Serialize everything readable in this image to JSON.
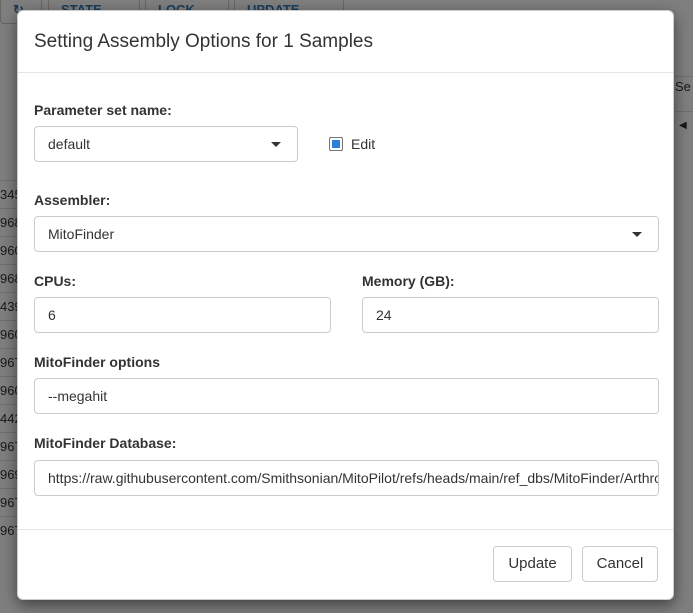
{
  "background": {
    "toolbar_buttons": [
      "STATE",
      "LOCK",
      "UPDATE"
    ],
    "row_fragments": [
      "345",
      "968",
      "960",
      "968",
      "439",
      "960",
      "967",
      "960",
      "442",
      "967",
      "969",
      "967",
      "967"
    ],
    "right_header": "Se"
  },
  "modal": {
    "title": "Setting Assembly Options for 1 Samples",
    "parameter_set": {
      "label": "Parameter set name:",
      "value": "default",
      "edit_label": "Edit",
      "edit_checked": true
    },
    "assembler": {
      "label": "Assembler:",
      "value": "MitoFinder"
    },
    "cpus": {
      "label": "CPUs:",
      "value": "6"
    },
    "memory": {
      "label": "Memory (GB):",
      "value": "24"
    },
    "options": {
      "label": "MitoFinder options",
      "value": "--megahit"
    },
    "database": {
      "label": "MitoFinder Database:",
      "value": "https://raw.githubusercontent.com/Smithsonian/MitoPilot/refs/heads/main/ref_dbs/MitoFinder/Arthropoda.gb"
    },
    "footer": {
      "update_label": "Update",
      "cancel_label": "Cancel"
    }
  },
  "colors": {
    "checkbox_fill": "#2f7fd6",
    "overlay": "rgba(0,0,0,0.5)"
  }
}
